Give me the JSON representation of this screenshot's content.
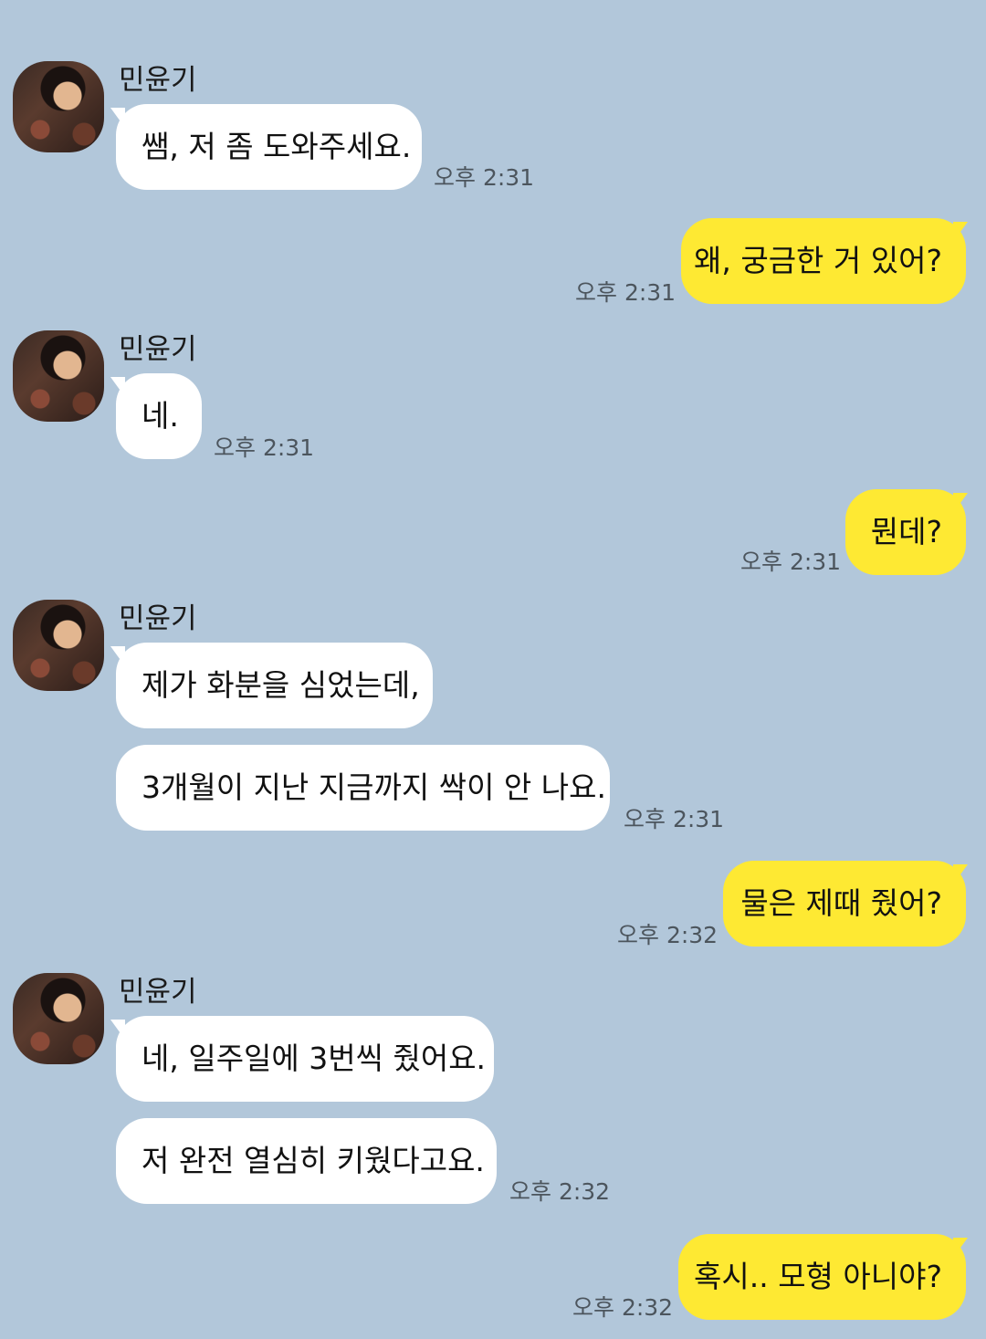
{
  "contact_name": "민윤기",
  "messages": [
    {
      "side": "in",
      "text": "쌤, 저 좀 도와주세요.",
      "time": "오후 2:31"
    },
    {
      "side": "out",
      "text": "왜, 궁금한 거 있어?",
      "time": "오후 2:31"
    },
    {
      "side": "in",
      "text": "네.",
      "time": "오후 2:31"
    },
    {
      "side": "out",
      "text": "뭔데?",
      "time": "오후 2:31"
    },
    {
      "side": "in",
      "text": "제가 화분을 심었는데,",
      "time": ""
    },
    {
      "side": "in",
      "text": "3개월이 지난 지금까지 싹이 안 나요.",
      "time": "오후 2:31"
    },
    {
      "side": "out",
      "text": "물은 제때 줬어?",
      "time": "오후 2:32"
    },
    {
      "side": "in",
      "text": "네, 일주일에 3번씩 줬어요.",
      "time": ""
    },
    {
      "side": "in",
      "text": "저 완전 열심히 키웠다고요.",
      "time": "오후 2:32"
    },
    {
      "side": "out",
      "text": "혹시.. 모형 아니야?",
      "time": "오후 2:32"
    }
  ],
  "colors": {
    "background": "#b2c7da",
    "incoming_bubble": "#ffffff",
    "outgoing_bubble": "#fee933"
  },
  "icons": {
    "avatar": "profile-photo-avatar"
  }
}
